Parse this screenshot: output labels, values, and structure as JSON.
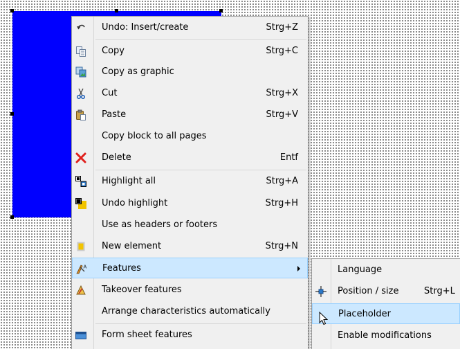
{
  "colors": {
    "block": "#0000ff",
    "menu_bg": "#f0f0f0",
    "highlight": "#cce8ff",
    "highlight_border": "#99d1ff"
  },
  "context_menu": {
    "items": [
      {
        "label": "Undo: Insert/create",
        "shortcut": "Strg+Z",
        "icon": "undo-icon"
      },
      {
        "label": "Copy",
        "shortcut": "Strg+C",
        "icon": "copy-icon"
      },
      {
        "label": "Copy as graphic",
        "shortcut": "",
        "icon": "copy-graphic-icon"
      },
      {
        "label": "Cut",
        "shortcut": "Strg+X",
        "icon": "scissors-icon"
      },
      {
        "label": "Paste",
        "shortcut": "Strg+V",
        "icon": "paste-icon"
      },
      {
        "label": "Copy block to all pages",
        "shortcut": "",
        "icon": ""
      },
      {
        "label": "Delete",
        "shortcut": "Entf",
        "icon": "delete-x-icon"
      },
      {
        "label": "Highlight all",
        "shortcut": "Strg+A",
        "icon": "highlight-all-icon"
      },
      {
        "label": "Undo highlight",
        "shortcut": "Strg+H",
        "icon": "undo-highlight-icon"
      },
      {
        "label": "Use as headers or footers",
        "shortcut": "",
        "icon": ""
      },
      {
        "label": "New element",
        "shortcut": "Strg+N",
        "icon": "new-element-icon"
      },
      {
        "label": "Features",
        "shortcut": "",
        "icon": "features-icon",
        "submenu": true,
        "highlighted": true
      },
      {
        "label": "Takeover features",
        "shortcut": "",
        "icon": "takeover-features-icon"
      },
      {
        "label": "Arrange characteristics automatically",
        "shortcut": "",
        "icon": ""
      },
      {
        "label": "Form sheet features",
        "shortcut": "",
        "icon": "form-sheet-icon"
      }
    ]
  },
  "submenu": {
    "items": [
      {
        "label": "Language",
        "shortcut": "",
        "icon": ""
      },
      {
        "label": "Position / size",
        "shortcut": "Strg+L",
        "icon": "position-size-icon"
      },
      {
        "label": "Placeholder",
        "shortcut": "",
        "icon": "",
        "highlighted": true
      },
      {
        "label": "Enable modifications",
        "shortcut": "",
        "icon": ""
      }
    ]
  }
}
